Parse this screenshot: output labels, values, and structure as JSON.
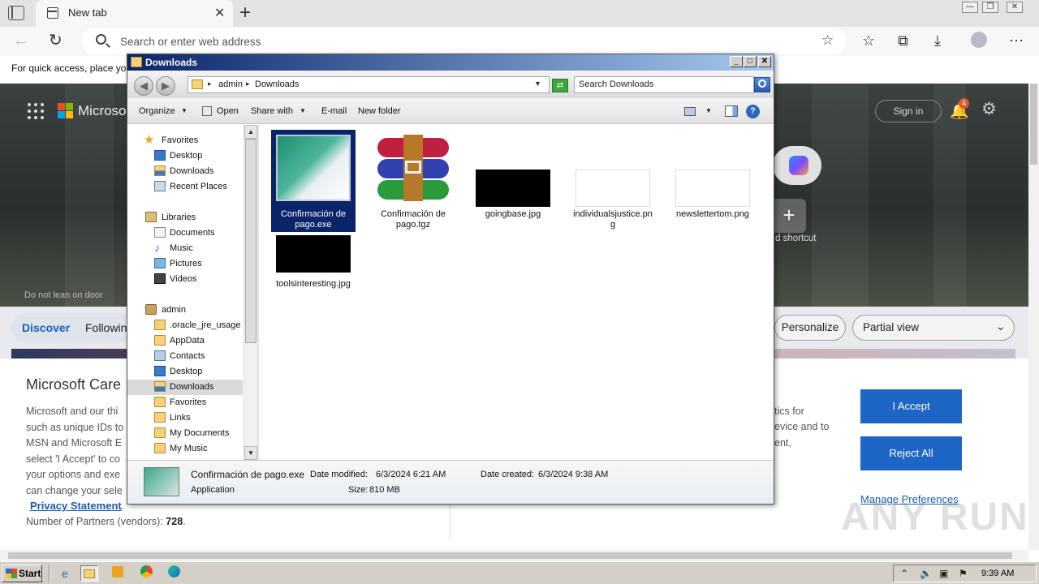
{
  "browser": {
    "tab_title": "New tab",
    "address_placeholder": "Search or enter web address",
    "quick_access_text": "For quick access, place you"
  },
  "newtab": {
    "brand": "Microso",
    "signin_label": "Sign in",
    "notification_count": "4",
    "add_shortcut_label": "d shortcut",
    "sign_text": "Do not lean on door",
    "feed": {
      "discover_label": "Discover",
      "following_label": "Followin",
      "personalize_label": "Personalize",
      "view_select_value": "Partial view"
    }
  },
  "consent": {
    "title": "Microsoft Care",
    "left_lines": [
      "Microsoft and our thi",
      "such as unique IDs to",
      "MSN and Microsoft E",
      "select 'I Accept' to co",
      "your options and exe",
      "can change your sele"
    ],
    "right_lines": [
      "tics for",
      "evice and to",
      "ent,"
    ],
    "privacy_link": "Privacy Statement",
    "privacy_suffix": ".",
    "partners_label": "Number of Partners (vendors): ",
    "partners_count": "728",
    "partners_suffix": ".",
    "accept_label": "I Accept",
    "reject_label": "Reject All",
    "manage_label": "Manage Preferences"
  },
  "watermark": "ANY RUN",
  "explorer": {
    "title": "Downloads",
    "breadcrumb": [
      "admin",
      "Downloads"
    ],
    "search_placeholder": "Search Downloads",
    "commands": {
      "organize": "Organize",
      "open": "Open",
      "share_with": "Share with",
      "email": "E-mail",
      "new_folder": "New folder",
      "help": "?"
    },
    "nav": {
      "favorites_header": "Favorites",
      "favorites": [
        "Desktop",
        "Downloads",
        "Recent Places"
      ],
      "libraries_header": "Libraries",
      "libraries": [
        "Documents",
        "Music",
        "Pictures",
        "Videos"
      ],
      "user_header": "admin",
      "user_folders": [
        ".oracle_jre_usage",
        "AppData",
        "Contacts",
        "Desktop",
        "Downloads",
        "Favorites",
        "Links",
        "My Documents",
        "My Music"
      ]
    },
    "files": [
      {
        "name": "Confirmación de pago.exe",
        "selected": true
      },
      {
        "name": "Confirmación de pago.tgz",
        "selected": false
      },
      {
        "name": "goingbase.jpg",
        "selected": false
      },
      {
        "name": "individualsjustice.png",
        "selected": false
      },
      {
        "name": "newslettertom.png",
        "selected": false
      },
      {
        "name": "toolsinteresting.jpg",
        "selected": false
      }
    ],
    "details": {
      "filename": "Confirmación de pago.exe",
      "type": "Application",
      "modified_label": "Date modified:",
      "modified_value": "6/3/2024 6:21 AM",
      "created_label": "Date created:",
      "created_value": "6/3/2024 9:38 AM",
      "size_label": "Size:",
      "size_value": "810 MB"
    }
  },
  "taskbar": {
    "start_label": "Start",
    "clock": "9:39 AM"
  }
}
